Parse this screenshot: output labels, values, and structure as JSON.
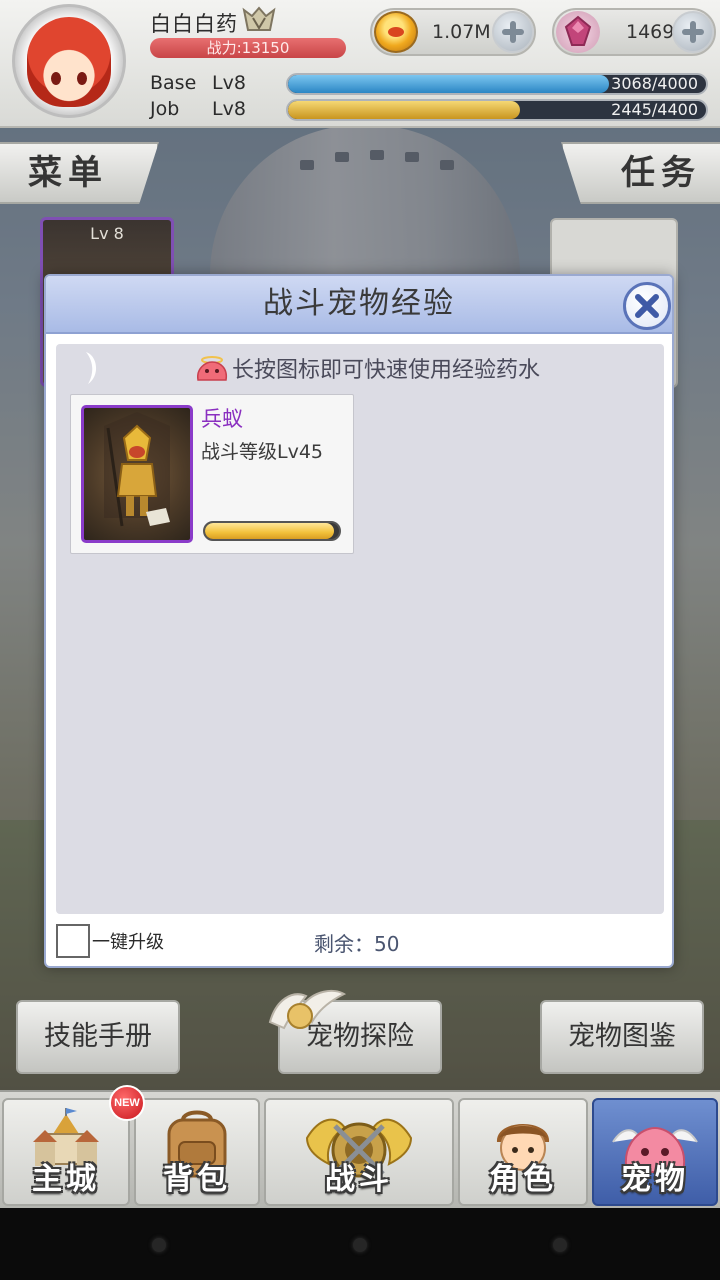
{
  "header": {
    "player_name": "白白白药",
    "combat_power": "战力:13150",
    "base": {
      "label": "Base",
      "level": "Lv8",
      "progress_text": "3068/4000",
      "current": 3068,
      "max": 4000
    },
    "job": {
      "label": "Job",
      "level": "Lv8",
      "progress_text": "2445/4400",
      "current": 2445,
      "max": 4400
    },
    "gold": {
      "value": "1.07M",
      "icon": "gold-coin-icon"
    },
    "gems": {
      "value": "1469",
      "icon": "pink-gem-icon"
    }
  },
  "side_buttons": {
    "menu": "菜单",
    "tasks": "任务"
  },
  "left_card": {
    "level": "Lv 8"
  },
  "dialog": {
    "title": "战斗宠物经验",
    "hint": "长按图标即可快速使用经验药水",
    "pet": {
      "name": "兵蚁",
      "level": "战斗等级Lv45",
      "exp_fraction": 0.96
    },
    "one_key_label": "一键升级",
    "remaining": "剩余：50"
  },
  "action_buttons": {
    "skill_book": "技能手册",
    "pet_adventure": "宠物探险",
    "pet_catalog": "宠物图鉴"
  },
  "bottom_nav": [
    {
      "label": "主城",
      "icon": "castle-icon",
      "badge": "NEW"
    },
    {
      "label": "背包",
      "icon": "backpack-icon"
    },
    {
      "label": "战斗",
      "icon": "winged-shield-icon"
    },
    {
      "label": "角色",
      "icon": "character-icon"
    },
    {
      "label": "宠物",
      "icon": "pet-poring-icon"
    }
  ],
  "colors": {
    "accent_blue": "#a9bbe6",
    "pet_name_purple": "#8a2fc0",
    "base_bar": "#3d9ad6",
    "job_bar": "#e2b238",
    "power_bar": "#c84547"
  }
}
